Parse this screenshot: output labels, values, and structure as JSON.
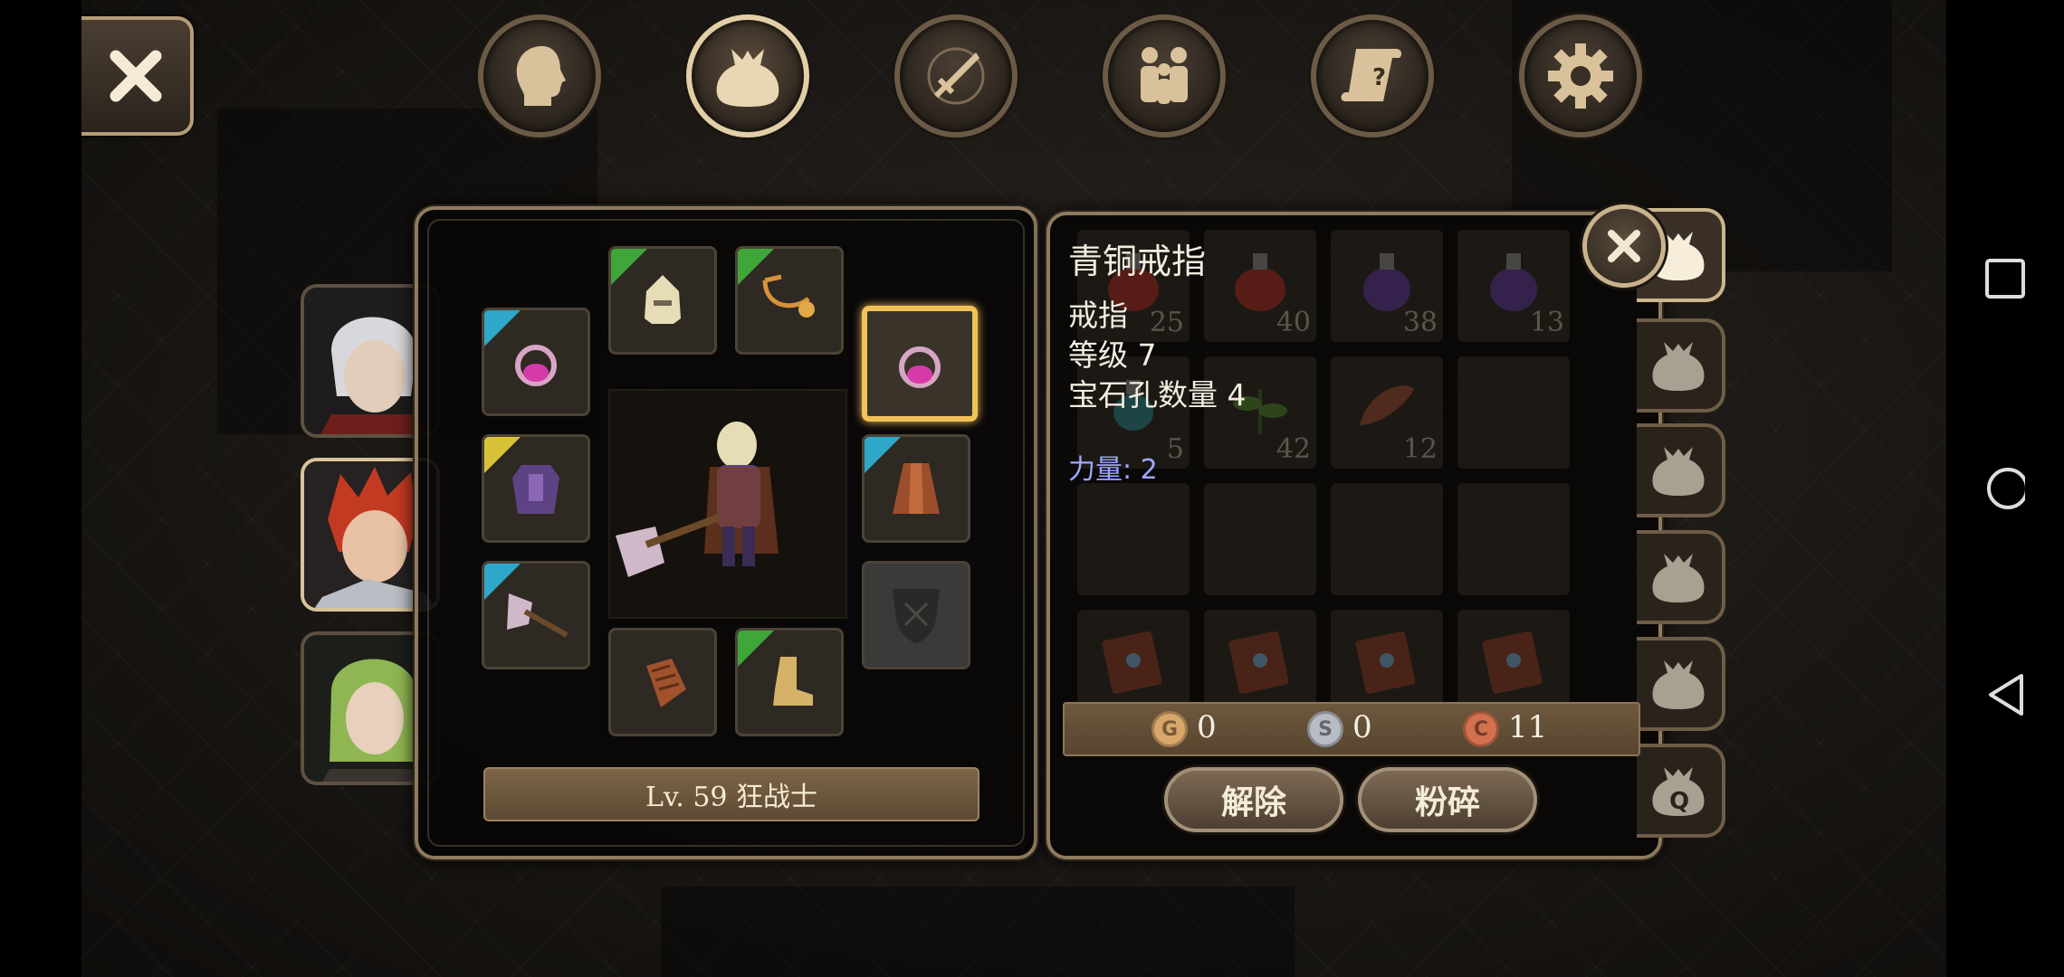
{
  "top_tabs": [
    {
      "id": "character",
      "icon": "head-silhouette-icon"
    },
    {
      "id": "inventory",
      "icon": "bag-icon",
      "active": true
    },
    {
      "id": "skills",
      "icon": "sword-compass-icon"
    },
    {
      "id": "party",
      "icon": "party-people-icon"
    },
    {
      "id": "quests",
      "icon": "scroll-question-icon"
    },
    {
      "id": "settings",
      "icon": "gear-icon"
    }
  ],
  "equipment": {
    "level_label": "Lv. 59 狂战士",
    "slots": [
      {
        "id": "ring-left",
        "icon": "ring-icon",
        "rarity": "#2ea7c9"
      },
      {
        "id": "helmet",
        "icon": "helmet-icon",
        "rarity": "#3fa63a"
      },
      {
        "id": "necklace",
        "icon": "necklace-icon",
        "rarity": "#3fa63a"
      },
      {
        "id": "ring-right",
        "icon": "ring-icon",
        "selected": true
      },
      {
        "id": "armor",
        "icon": "armor-icon",
        "rarity": "#d9c23a"
      },
      {
        "id": "cape",
        "icon": "cape-icon",
        "rarity": "#2ea7c9"
      },
      {
        "id": "weapon",
        "icon": "axe-icon",
        "rarity": "#2ea7c9"
      },
      {
        "id": "shield",
        "icon": "shield-placeholder-icon"
      },
      {
        "id": "gloves",
        "icon": "gloves-icon"
      },
      {
        "id": "boots",
        "icon": "boots-icon",
        "rarity": "#3fa63a"
      }
    ]
  },
  "portraits": [
    {
      "name": "white-haired-hero",
      "hair": "#d8d8dc"
    },
    {
      "name": "red-haired-hero",
      "hair": "#c33a22",
      "active": true
    },
    {
      "name": "green-haired-hero",
      "hair": "#8fb653"
    }
  ],
  "tooltip": {
    "title": "青铜戒指",
    "type": "戒指",
    "level": "等级 7",
    "sockets": "宝石孔数量 4",
    "stat": "力量: 2"
  },
  "inventory": {
    "cells": [
      {
        "count": "25",
        "icon": "red-potion-icon"
      },
      {
        "count": "40",
        "icon": "red-potion-icon"
      },
      {
        "count": "38",
        "icon": "purple-potion-icon"
      },
      {
        "count": "13",
        "icon": "purple-potion-icon"
      },
      {
        "count": "5",
        "icon": "teal-potion-icon"
      },
      {
        "count": "42",
        "icon": "herb-icon"
      },
      {
        "count": "12",
        "icon": "feather-icon"
      },
      {
        "count": ""
      },
      {
        "count": ""
      },
      {
        "count": ""
      },
      {
        "count": ""
      },
      {
        "count": ""
      },
      {
        "count": "",
        "icon": "book-icon"
      },
      {
        "count": "",
        "icon": "book-icon"
      },
      {
        "count": "",
        "icon": "book-icon"
      },
      {
        "count": "",
        "icon": "book-icon"
      }
    ]
  },
  "currency": {
    "gold_symbol": "G",
    "gold": "0",
    "silver_symbol": "S",
    "silver": "0",
    "copper_symbol": "C",
    "copper": "11"
  },
  "actions": {
    "unequip": "解除",
    "smash": "粉碎"
  },
  "side_tabs": [
    {
      "id": "bag-1",
      "active": true
    },
    {
      "id": "bag-2"
    },
    {
      "id": "bag-3"
    },
    {
      "id": "bag-4"
    },
    {
      "id": "bag-5"
    },
    {
      "id": "bag-quest",
      "letter": "Q"
    }
  ],
  "colors": {
    "accent": "#f2c25a",
    "panel_border": "#8f7b5d",
    "stat_text": "#9fa7ff"
  }
}
